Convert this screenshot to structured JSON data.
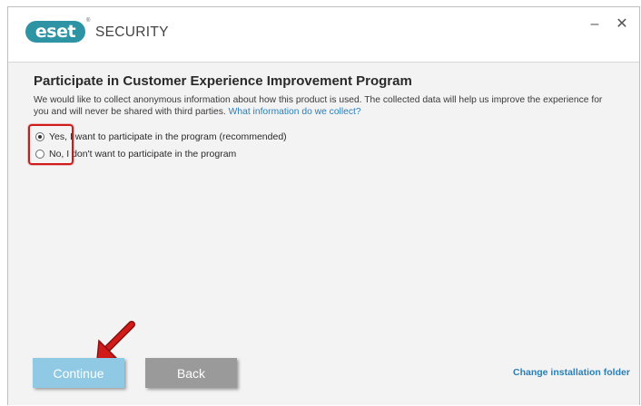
{
  "app": {
    "logo_text": "eset",
    "product_name": "SECURITY",
    "minimize_glyph": "–",
    "close_glyph": "✕"
  },
  "page": {
    "heading": "Participate in Customer Experience Improvement Program",
    "description": "We would like to collect anonymous information about how this product is used. The collected data will help us improve the experience for you and will never be shared with third parties.",
    "description_link": "What information do we collect?"
  },
  "options": {
    "yes_label": "Yes, I want to participate in the program (recommended)",
    "no_label": "No, I don't want to participate in the program",
    "selected": "yes"
  },
  "footer": {
    "continue_label": "Continue",
    "back_label": "Back",
    "change_folder_label": "Change installation folder"
  },
  "colors": {
    "brand": "#2e94a3",
    "link": "#2a7fb8",
    "continue_button": "#8fc9e3",
    "back_button": "#9a9a9a",
    "annotation_red": "#d11a1a"
  },
  "icons": {
    "minimize": "minimize-icon",
    "close": "close-icon",
    "annotation_arrow": "arrow-icon"
  }
}
